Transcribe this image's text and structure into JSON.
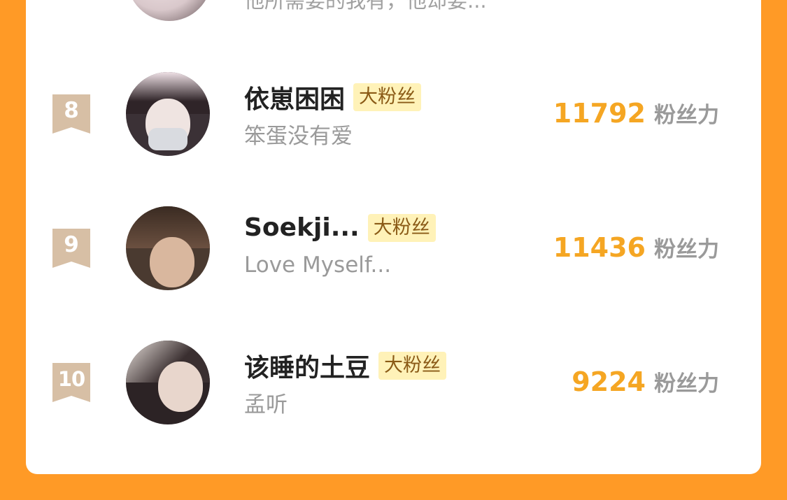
{
  "partial_row": {
    "bio": "他所需要的我有，他却要..."
  },
  "fans": [
    {
      "rank": "8",
      "name": "依崽困困",
      "badge": "大粉丝",
      "bio": "笨蛋没有爱",
      "score": "11792",
      "score_unit": "粉丝力"
    },
    {
      "rank": "9",
      "name": "Soekji...",
      "badge": "大粉丝",
      "bio": "Love Myself...",
      "score": "11436",
      "score_unit": "粉丝力"
    },
    {
      "rank": "10",
      "name": "该睡的土豆",
      "badge": "大粉丝",
      "bio": "孟听",
      "score": "9224",
      "score_unit": "粉丝力"
    }
  ],
  "colors": {
    "background": "#FF9A26",
    "score": "#F5A623",
    "badge_bg": "#FFF2B8",
    "rank_bg": "#D7BFA5"
  }
}
